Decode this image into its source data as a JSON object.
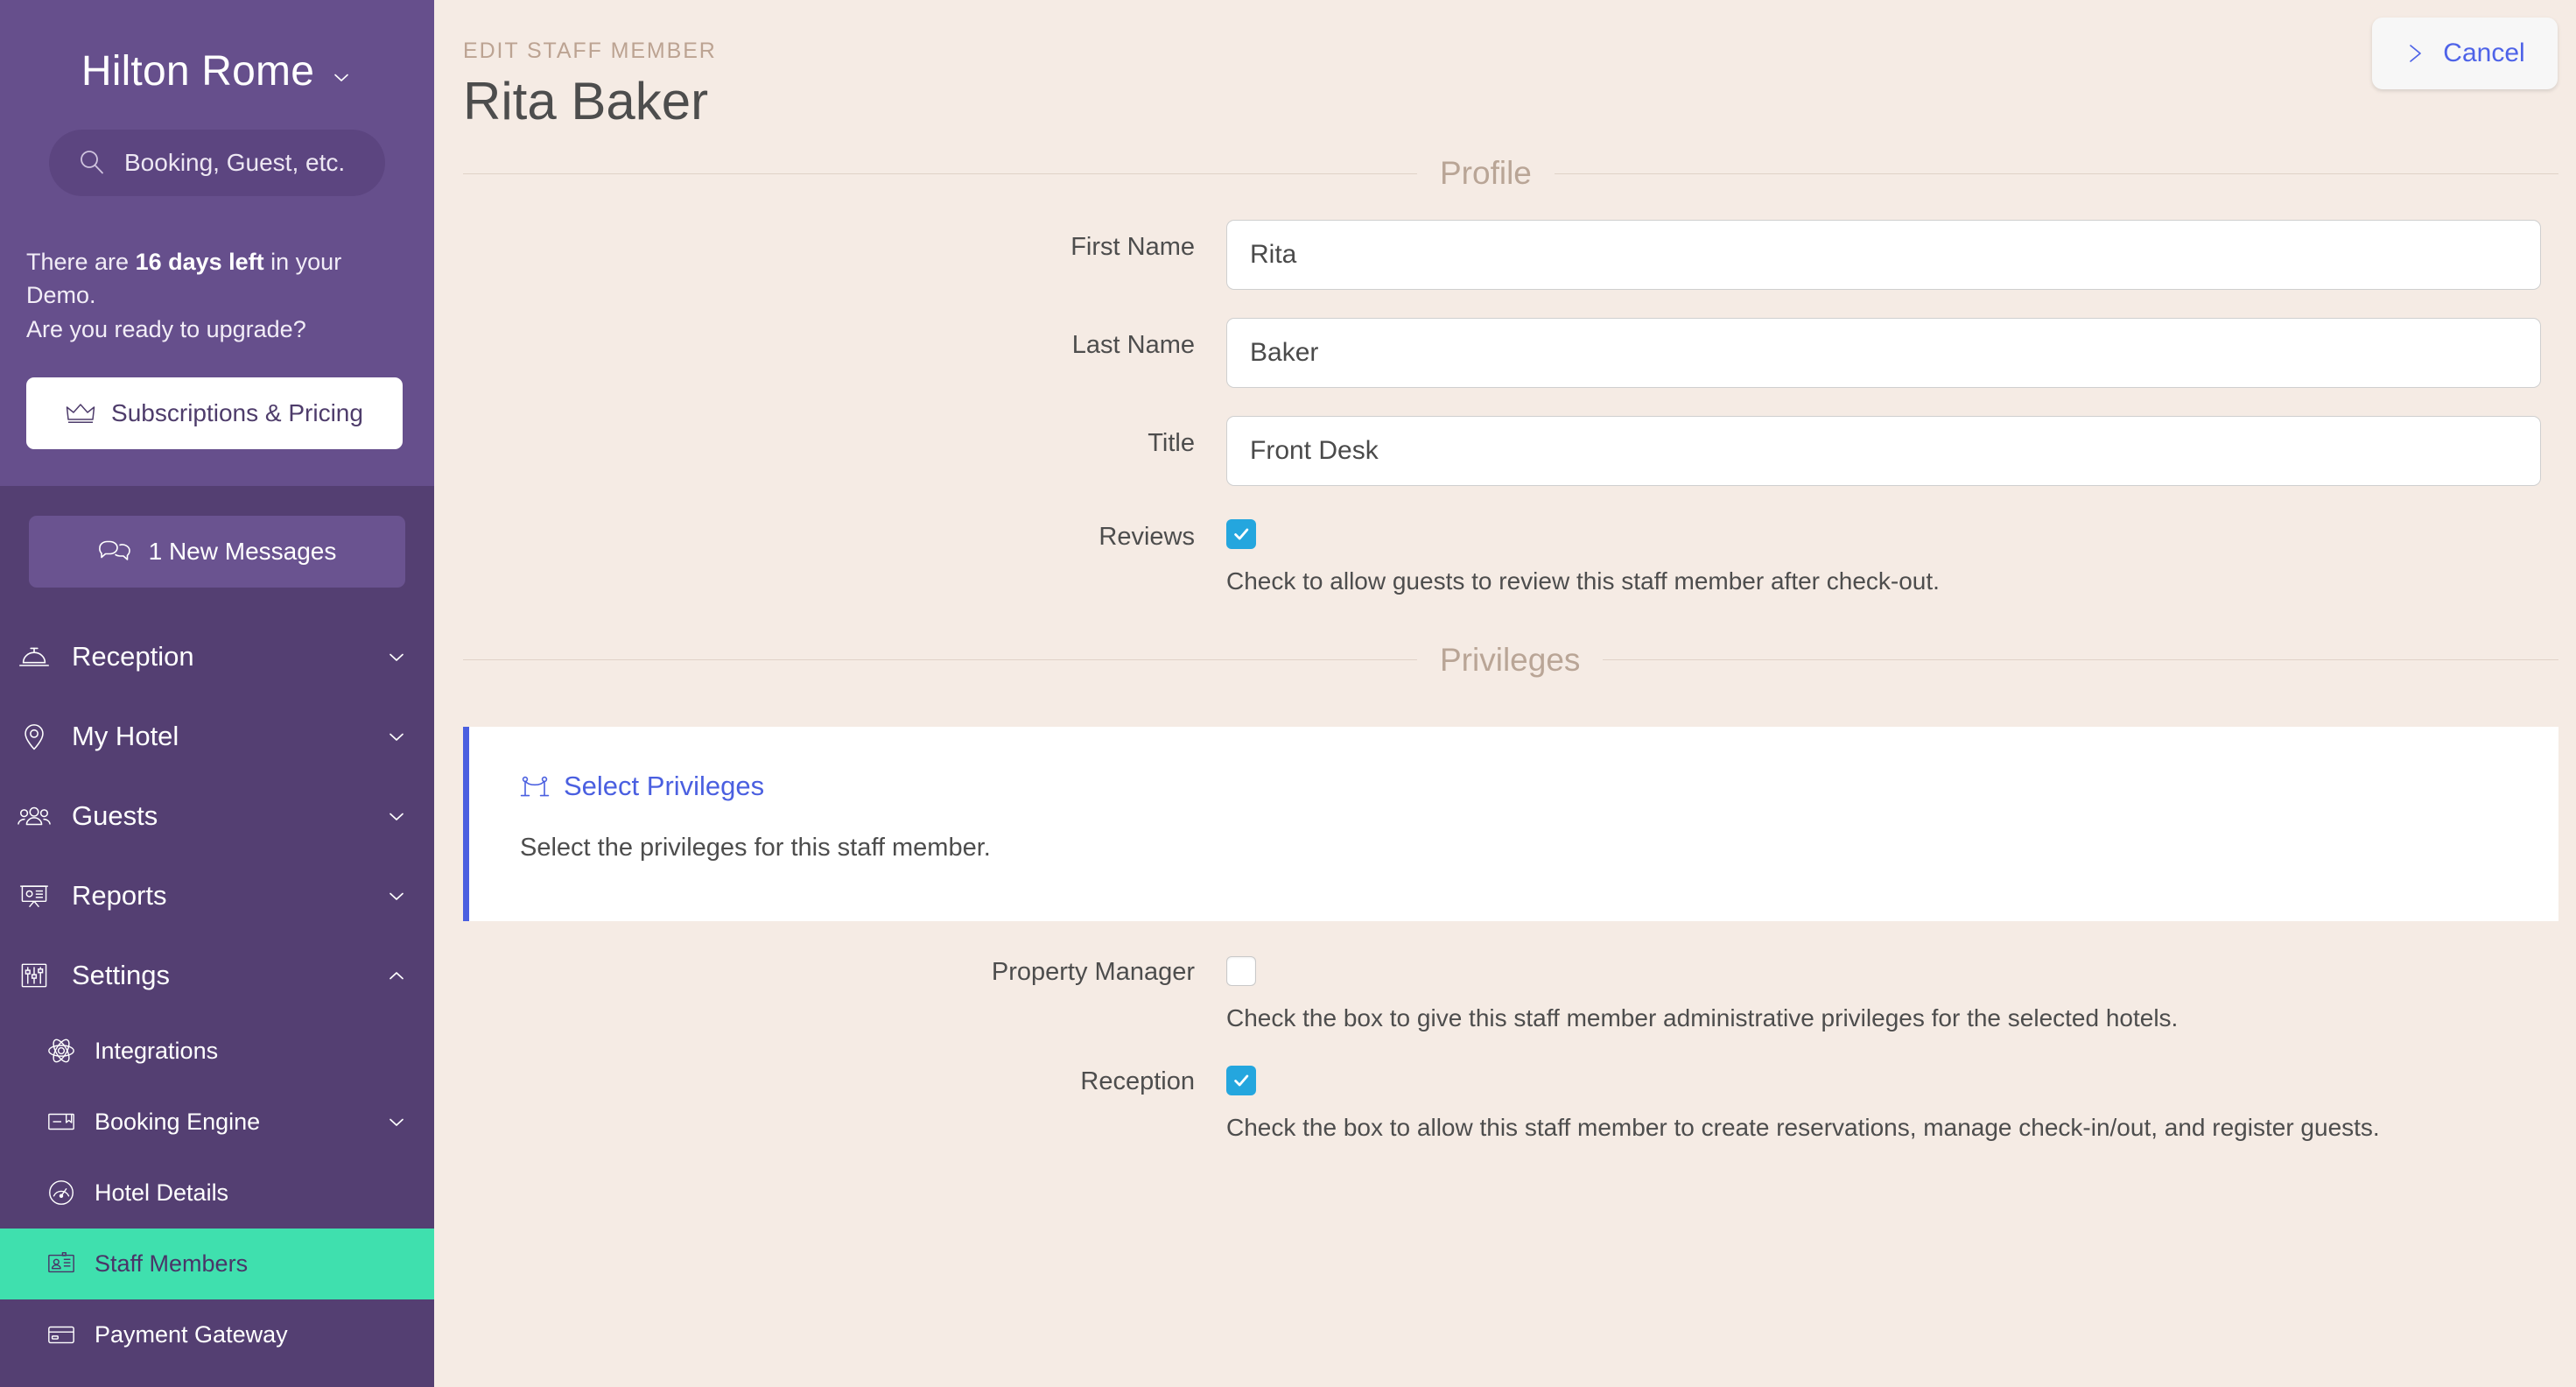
{
  "sidebar": {
    "brand": {
      "name": "Hilton Rome",
      "caret_icon": "chevron-down-icon"
    },
    "search": {
      "placeholder": "Booking, Guest, etc.",
      "icon": "search-icon"
    },
    "demo": {
      "line1_pre": "There are ",
      "line1_strong": "16 days left",
      "line1_post": " in your Demo.",
      "line2": "Are you ready to upgrade?",
      "cta_label": "Subscriptions & Pricing",
      "cta_icon": "crown-icon"
    },
    "messages": {
      "label": "1 New Messages",
      "icon": "chat-bubbles-icon"
    },
    "nav": [
      {
        "label": "Reception",
        "icon": "service-bell-icon",
        "caret": "chevron-down-icon",
        "level": "top",
        "active": false
      },
      {
        "label": "My Hotel",
        "icon": "map-pin-icon",
        "caret": "chevron-down-icon",
        "level": "top",
        "active": false
      },
      {
        "label": "Guests",
        "icon": "people-icon",
        "caret": "chevron-down-icon",
        "level": "top",
        "active": false
      },
      {
        "label": "Reports",
        "icon": "presentation-icon",
        "caret": "chevron-down-icon",
        "level": "top",
        "active": false
      },
      {
        "label": "Settings",
        "icon": "sliders-icon",
        "caret": "chevron-up-icon",
        "level": "top",
        "active": false
      },
      {
        "label": "Integrations",
        "icon": "atom-icon",
        "caret": "",
        "level": "sub",
        "active": false
      },
      {
        "label": "Booking Engine",
        "icon": "booking-card-icon",
        "caret": "chevron-down-icon",
        "level": "sub",
        "active": false
      },
      {
        "label": "Hotel Details",
        "icon": "gauge-icon",
        "caret": "",
        "level": "sub",
        "active": false
      },
      {
        "label": "Staff Members",
        "icon": "id-badge-icon",
        "caret": "",
        "level": "sub",
        "active": true
      },
      {
        "label": "Payment Gateway",
        "icon": "credit-card-icon",
        "caret": "",
        "level": "sub",
        "active": false
      }
    ]
  },
  "header": {
    "eyebrow": "EDIT STAFF MEMBER",
    "title": "Rita Baker",
    "cancel_label": "Cancel",
    "cancel_icon": "chevron-right-icon"
  },
  "sections": {
    "profile_label": "Profile",
    "privileges_label": "Privileges"
  },
  "profile": {
    "first_name": {
      "label": "First Name",
      "value": "Rita",
      "placeholder": ""
    },
    "last_name": {
      "label": "Last Name",
      "value": "Baker",
      "placeholder": ""
    },
    "title": {
      "label": "Title",
      "value": "Front Desk",
      "placeholder": ""
    },
    "reviews": {
      "label": "Reviews",
      "checked": true,
      "help": "Check to allow guests to review this staff member after check-out."
    }
  },
  "callout": {
    "icon": "velvet-rope-icon",
    "title": "Select Privileges",
    "body": "Select the privileges for this staff member."
  },
  "privileges": [
    {
      "label": "Property Manager",
      "checked": false,
      "help": "Check the box to give this staff member administrative privileges for the selected hotels."
    },
    {
      "label": "Reception",
      "checked": true,
      "help": "Check the box to allow this staff member to create reservations, manage check-in/out, and register guests."
    }
  ],
  "colors": {
    "sidebar_top": "#664F8C",
    "sidebar_bottom": "#543F72",
    "active_nav": "#3FE0AE",
    "page_bg": "#F5EBE4",
    "accent_blue": "#4A5FE0",
    "checkbox_blue": "#24A6DE",
    "section_label": "#B9A596"
  }
}
